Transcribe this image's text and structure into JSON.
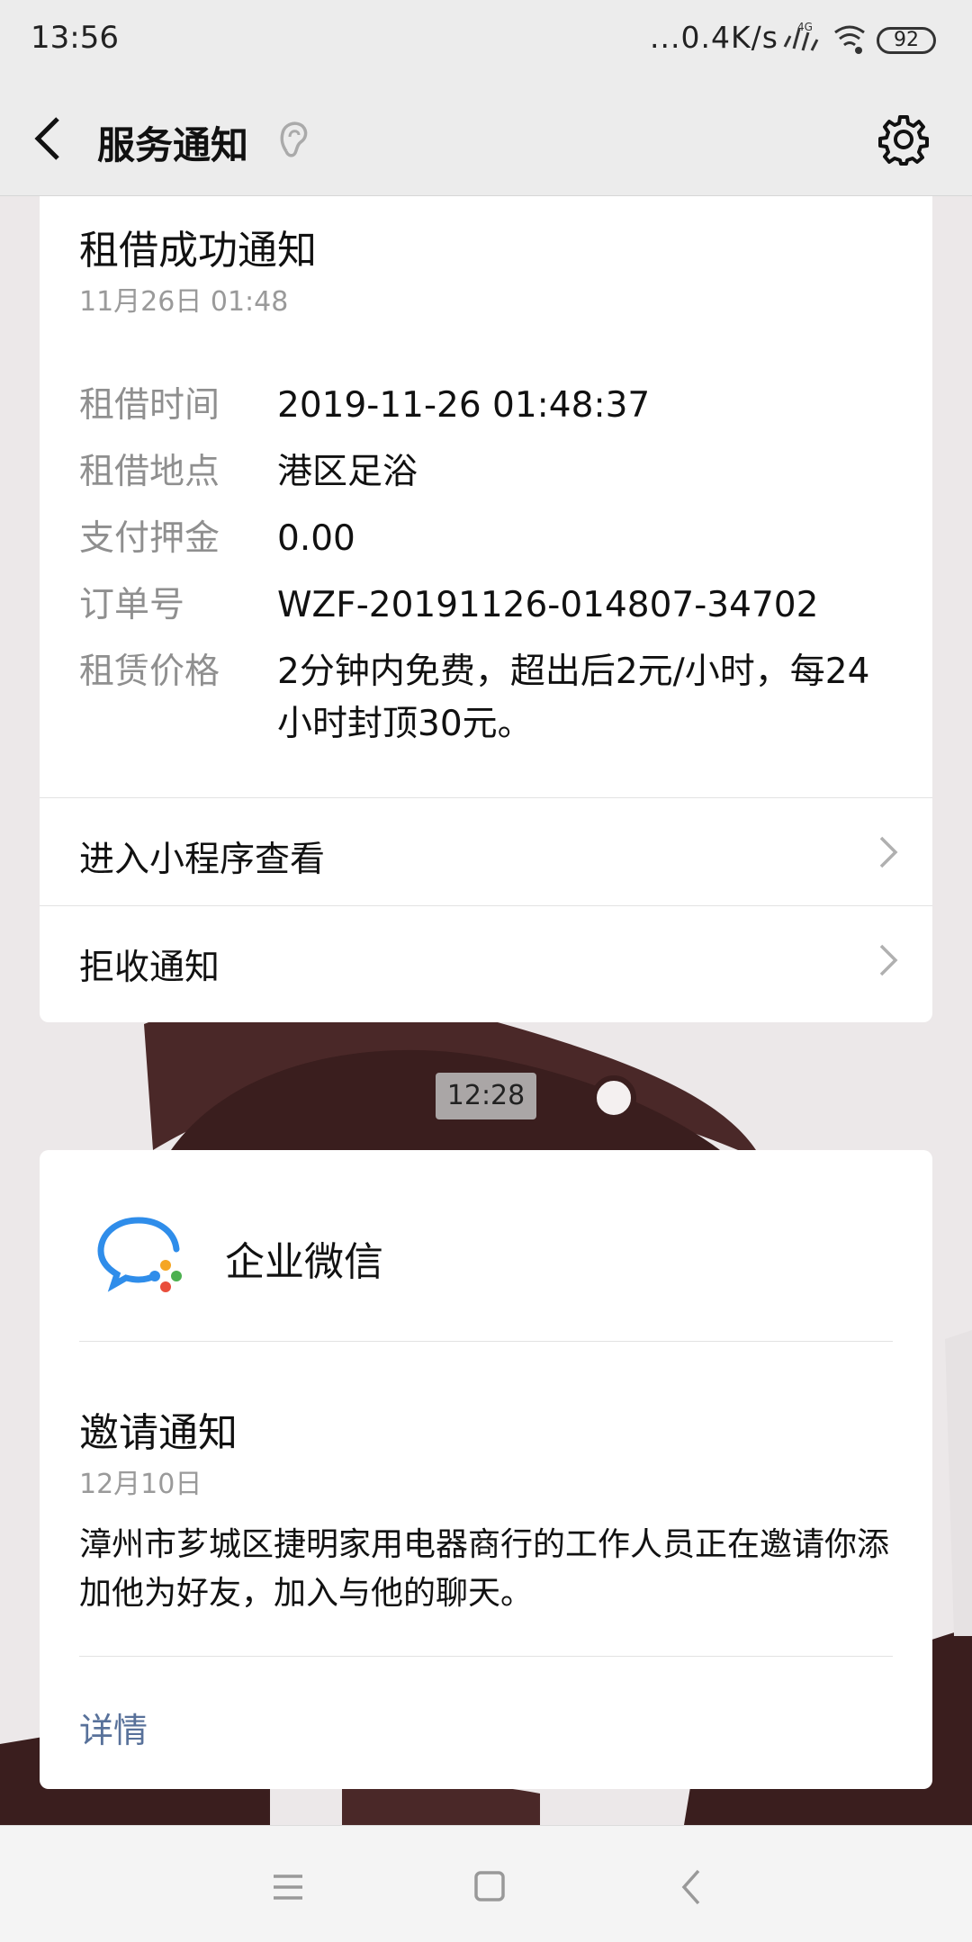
{
  "status_bar": {
    "time": "13:56",
    "network_speed": "...0.4K/s",
    "battery": "92"
  },
  "nav": {
    "title": "服务通知",
    "icons": [
      "back-arrow-icon",
      "ear-icon",
      "gear-icon"
    ]
  },
  "rental_card": {
    "title": "租借成功通知",
    "time": "11月26日  01:48",
    "rows": [
      {
        "label": "租借时间",
        "value": "2019-11-26 01:48:37"
      },
      {
        "label": "租借地点",
        "value": "港区足浴"
      },
      {
        "label": "支付押金",
        "value": "0.00"
      },
      {
        "label": "订单号",
        "value": "WZF-20191126-014807-34702"
      },
      {
        "label": "租赁价格",
        "value": "2分钟内免费，超出后2元/小时，每24小时封顶30元。"
      }
    ],
    "actions": [
      {
        "label": "进入小程序查看"
      },
      {
        "label": "拒收通知"
      }
    ]
  },
  "time_separator": "12:28",
  "invite_card": {
    "app_name": "企业微信",
    "title": "邀请通知",
    "date": "12月10日",
    "body": "漳州市芗城区捷明家用电器商行的工作人员正在邀请你添加他为好友，加入与他的聊天。",
    "link": "详情"
  },
  "colors": {
    "link": "#58719a",
    "muted": "#9a9a9a",
    "background": "#ececec"
  }
}
